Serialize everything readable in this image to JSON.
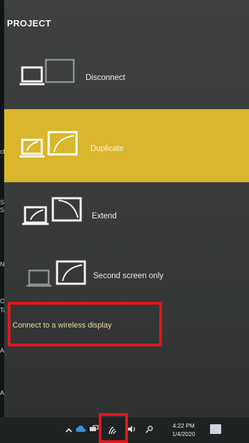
{
  "panel": {
    "title": "PROJECT",
    "options": [
      {
        "label": "Disconnect",
        "selected": false
      },
      {
        "label": "Duplicate",
        "selected": true
      },
      {
        "label": "Extend",
        "selected": false
      },
      {
        "label": "Second screen only",
        "selected": false
      }
    ],
    "connect_link": "Connect to a wireless display"
  },
  "background_fragments": [
    "ch",
    "S",
    "Sm",
    "Ne",
    "Or",
    "Ta",
    "Add",
    "Add"
  ],
  "taskbar": {
    "time": "4:22 PM",
    "date": "1/4/2020",
    "icons": [
      "chevron-up-icon",
      "cloud-icon",
      "network-icon",
      "wireless-network-icon",
      "volume-icon",
      "pen-icon",
      "notification-icon"
    ]
  },
  "colors": {
    "accent": "#d9b62b",
    "highlight_box": "#e5141b",
    "panel_bg": "#3a3c3b",
    "taskbar_bg": "#1e2222"
  }
}
